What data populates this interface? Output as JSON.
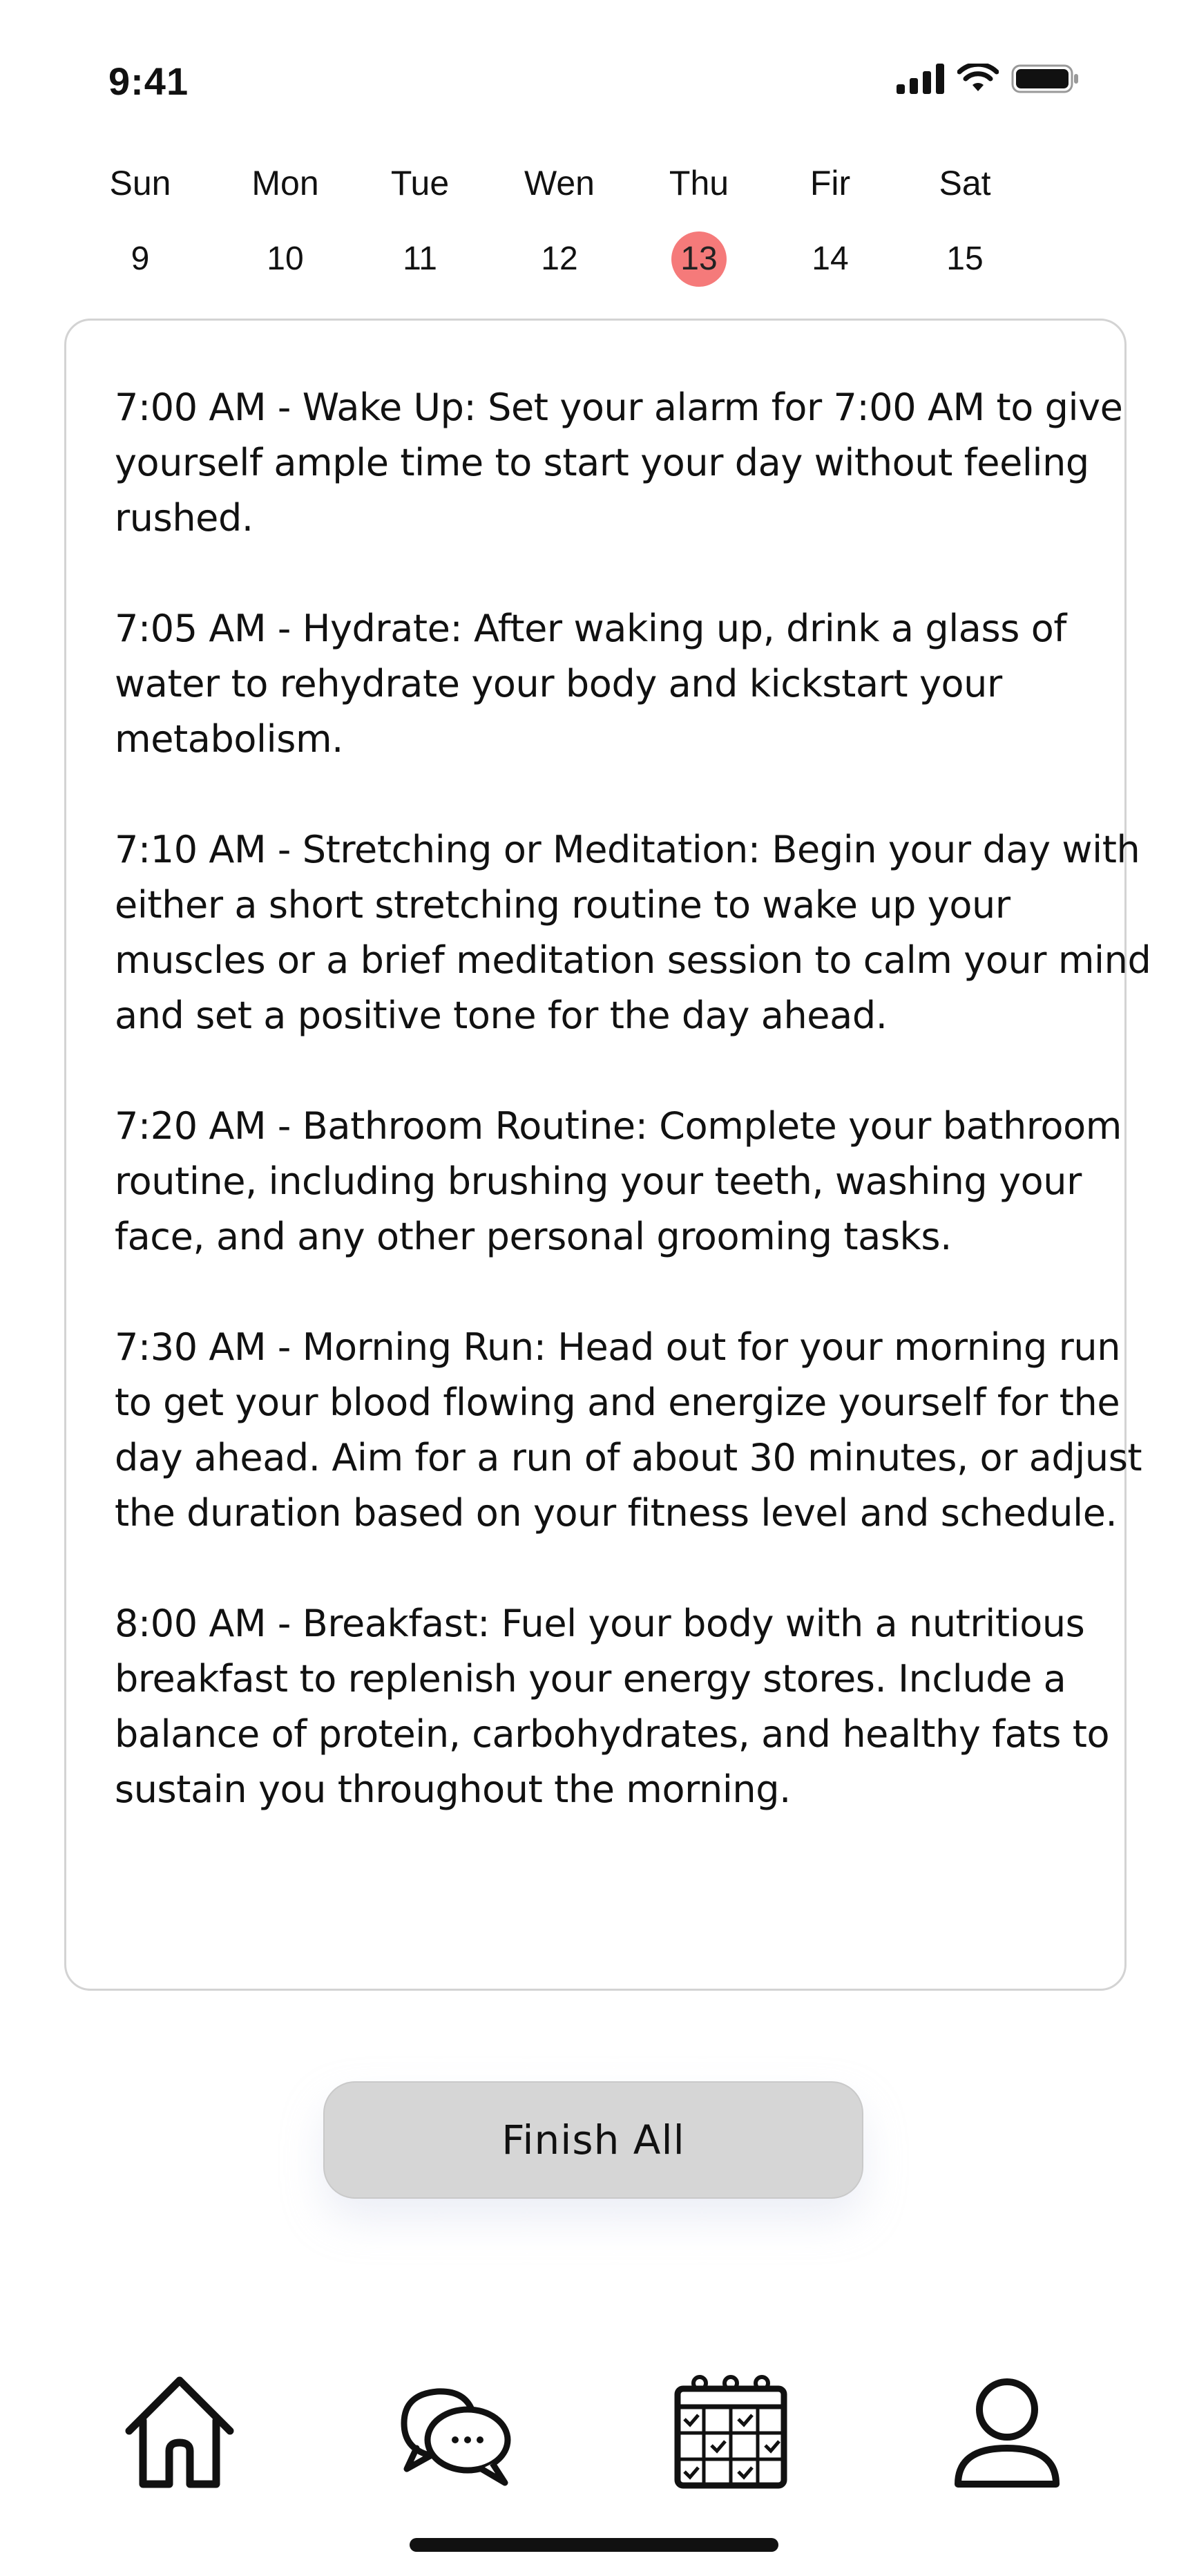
{
  "status_bar": {
    "time": "9:41"
  },
  "week": {
    "days": [
      {
        "name": "Sun",
        "num": "9"
      },
      {
        "name": "Mon",
        "num": "10"
      },
      {
        "name": "Tue",
        "num": "11"
      },
      {
        "name": "Wen",
        "num": "12"
      },
      {
        "name": "Thu",
        "num": "13"
      },
      {
        "name": "Fir",
        "num": "14"
      },
      {
        "name": "Sat",
        "num": "15"
      }
    ],
    "selected_day": "13"
  },
  "routine": {
    "entries": [
      "7:00 AM - Wake Up: Set your alarm for 7:00 AM to give yourself ample time to start your day without feeling rushed.",
      "7:05 AM - Hydrate: After waking up, drink a glass of water to rehydrate your body and kickstart your metabolism.",
      "7:10 AM - Stretching or Meditation: Begin your day with either a short stretching routine to wake up your muscles or a brief meditation session to calm your mind and set a positive tone for the day ahead.",
      "7:20 AM - Bathroom Routine: Complete your bathroom routine, including brushing your teeth, washing your face, and any other personal grooming tasks.",
      "7:30 AM - Morning Run: Head out for your morning run to get your blood flowing and energize yourself for the day ahead. Aim for a run of about 30 minutes, or adjust the duration based on your fitness level and schedule.",
      "8:00 AM - Breakfast: Fuel your body with a nutritious breakfast to replenish your energy stores. Include a balance of protein, carbohydrates, and healthy fats to sustain you throughout the morning."
    ]
  },
  "actions": {
    "finish_label": "Finish All"
  },
  "tab_bar": {
    "items": [
      {
        "icon": "home-icon"
      },
      {
        "icon": "chat-icon"
      },
      {
        "icon": "calendar-icon"
      },
      {
        "icon": "profile-icon"
      }
    ]
  },
  "colors": {
    "selected_day": "#f57a7a",
    "button_bg": "#d6d6d6",
    "card_border": "#d3d3d3"
  }
}
